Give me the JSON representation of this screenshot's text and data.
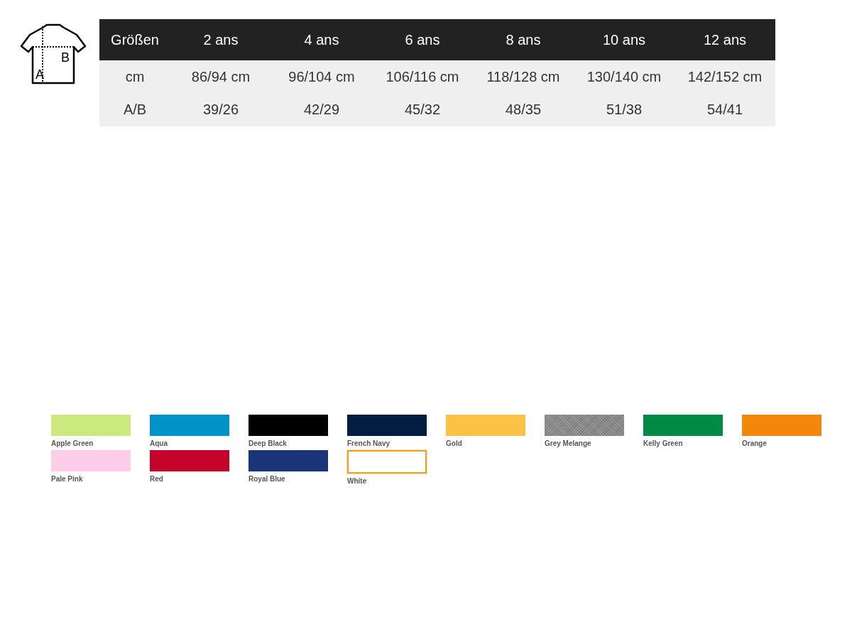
{
  "size_table": {
    "columns": [
      "Größen",
      "2 ans",
      "4 ans",
      "6 ans",
      "8 ans",
      "10 ans",
      "12 ans"
    ],
    "rows": [
      [
        "cm",
        "86/94 cm",
        "96/104 cm",
        "106/116 cm",
        "118/128 cm",
        "130/140 cm",
        "142/152 cm"
      ],
      [
        "A/B",
        "39/26",
        "42/29",
        "45/32",
        "48/35",
        "51/38",
        "54/41"
      ]
    ]
  },
  "shirt_labels": [
    "A",
    "B"
  ],
  "swatches": [
    {
      "name": "Apple Green",
      "color": "#cbe97f",
      "selected": false
    },
    {
      "name": "Aqua",
      "color": "#0093c8",
      "selected": false
    },
    {
      "name": "Deep Black",
      "color": "#000000",
      "selected": false
    },
    {
      "name": "French Navy",
      "color": "#021d40",
      "selected": false
    },
    {
      "name": "Gold",
      "color": "#fcc248",
      "selected": false
    },
    {
      "name": "Grey Melange",
      "color": "#8a8a8a",
      "selected": false
    },
    {
      "name": "Kelly Green",
      "color": "#008a44",
      "selected": false
    },
    {
      "name": "Orange",
      "color": "#f2870a",
      "selected": false
    },
    {
      "name": "Pale Pink",
      "color": "#fdcdea",
      "selected": false
    },
    {
      "name": "Red",
      "color": "#c4042a",
      "selected": false
    },
    {
      "name": "Royal Blue",
      "color": "#1b3477",
      "selected": false
    },
    {
      "name": "White",
      "color": "#ffffff",
      "selected": true
    }
  ]
}
